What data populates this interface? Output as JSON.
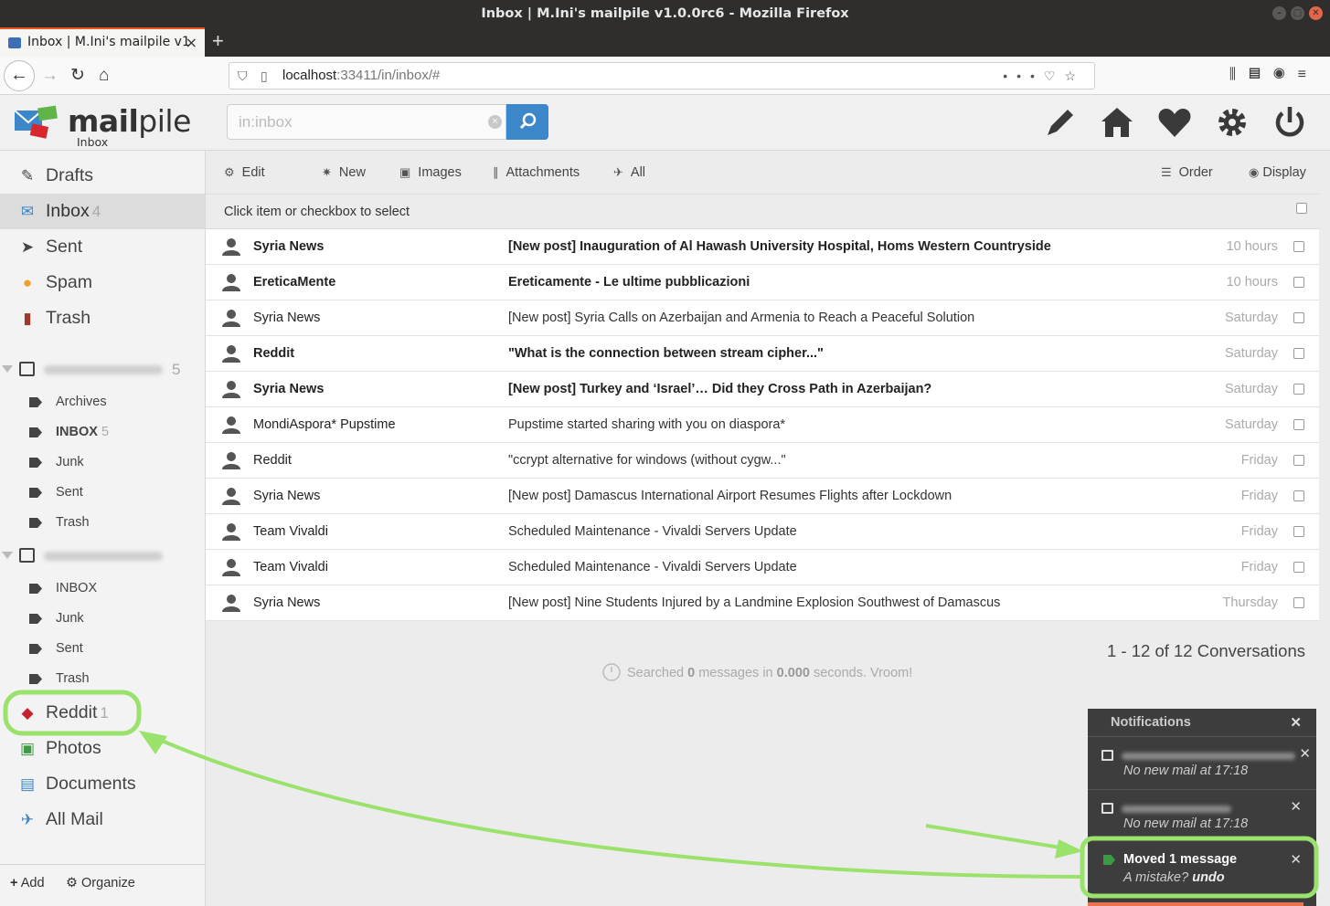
{
  "browser": {
    "window_title": "Inbox | M.Ini's mailpile v1.0.0rc6 - Mozilla Firefox",
    "tab_title": "Inbox | M.Ini's mailpile v1",
    "url_host": "localhost",
    "url_rest": ":33411/in/inbox/#"
  },
  "header": {
    "logo_text_bold": "mail",
    "logo_text": "pile",
    "logo_sub": "Inbox",
    "search_placeholder": "in:inbox"
  },
  "sidebar": {
    "main": [
      {
        "label": "Drafts",
        "count": ""
      },
      {
        "label": "Inbox",
        "count": "4"
      },
      {
        "label": "Sent",
        "count": ""
      },
      {
        "label": "Spam",
        "count": ""
      },
      {
        "label": "Trash",
        "count": ""
      }
    ],
    "account1": {
      "count": "5"
    },
    "account1_folders": [
      {
        "label": "Archives",
        "count": ""
      },
      {
        "label": "INBOX",
        "count": "5"
      },
      {
        "label": "Junk",
        "count": ""
      },
      {
        "label": "Sent",
        "count": ""
      },
      {
        "label": "Trash",
        "count": ""
      }
    ],
    "account2_folders": [
      {
        "label": "INBOX"
      },
      {
        "label": "Junk"
      },
      {
        "label": "Sent"
      },
      {
        "label": "Trash"
      }
    ],
    "tags": [
      {
        "label": "Reddit",
        "count": "1"
      },
      {
        "label": "Photos"
      },
      {
        "label": "Documents"
      },
      {
        "label": "All Mail"
      }
    ],
    "add_label": "Add",
    "organize_label": "Organize"
  },
  "toolbar": {
    "edit": "Edit",
    "new": "New",
    "images": "Images",
    "attachments": "Attachments",
    "all": "All",
    "order": "Order",
    "display": "Display"
  },
  "select_hint": "Click item or checkbox to select",
  "messages": [
    {
      "from": "Syria News",
      "subject": "[New post] Inauguration of Al Hawash University Hospital, Homs Western Countryside",
      "date": "10 hours",
      "unread": true
    },
    {
      "from": "EreticaMente",
      "subject": "Ereticamente - Le ultime pubblicazioni",
      "date": "10 hours",
      "unread": true
    },
    {
      "from": "Syria News",
      "subject": "[New post] Syria Calls on Azerbaijan and Armenia to Reach a Peaceful Solution",
      "date": "Saturday",
      "unread": false
    },
    {
      "from": "Reddit",
      "subject": "\"What is the connection between stream cipher...\"",
      "date": "Saturday",
      "unread": true
    },
    {
      "from": "Syria News",
      "subject": "[New post] Turkey and ‘Israel’… Did they Cross Path in Azerbaijan?",
      "date": "Saturday",
      "unread": true
    },
    {
      "from": "MondiAspora* Pupstime",
      "subject": "Pupstime started sharing with you on diaspora*",
      "date": "Saturday",
      "unread": false
    },
    {
      "from": "Reddit",
      "subject": "\"ccrypt alternative for windows (without cygw...\"",
      "date": "Friday",
      "unread": false
    },
    {
      "from": "Syria News",
      "subject": "[New post] Damascus International Airport Resumes Flights after Lockdown",
      "date": "Friday",
      "unread": false
    },
    {
      "from": "Team Vivaldi",
      "subject": "Scheduled Maintenance - Vivaldi Servers Update",
      "date": "Friday",
      "unread": false
    },
    {
      "from": "Team Vivaldi",
      "subject": "Scheduled Maintenance - Vivaldi Servers Update",
      "date": "Friday",
      "unread": false
    },
    {
      "from": "Syria News",
      "subject": "[New post] Nine Students Injured by a Landmine Explosion Southwest of Damascus",
      "date": "Thursday",
      "unread": false
    }
  ],
  "footer": {
    "count": "1 - 12 of 12 Conversations",
    "search_pre": "Searched",
    "search_num": "0",
    "search_mid": "messages in",
    "search_time": "0.000",
    "search_post": "seconds. Vroom!"
  },
  "notifications": {
    "title": "Notifications",
    "items": [
      {
        "message": "No new mail at 17:18"
      },
      {
        "message": "No new mail at 17:18"
      }
    ],
    "moved_title": "Moved 1 message",
    "moved_pre": "A mistake?",
    "moved_undo": "undo"
  },
  "colors": {
    "accent": "#3b87c9",
    "highlight": "#9be26c",
    "reddit_tag": "#c8202e"
  }
}
